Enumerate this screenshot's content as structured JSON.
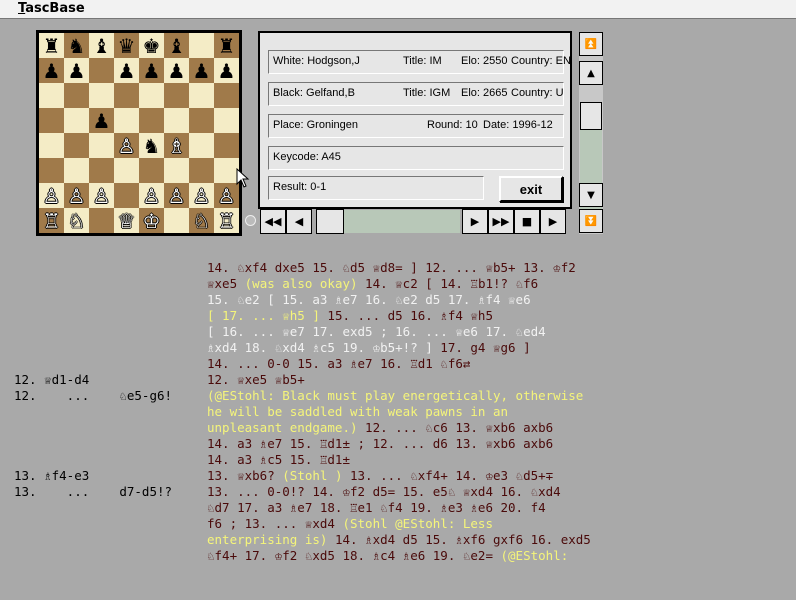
{
  "app": {
    "title": "TascBase"
  },
  "board": {
    "rows": [
      [
        "♜",
        "♞",
        "♝",
        "♛",
        "♚",
        "♝",
        "",
        ""
      ],
      [
        "♟",
        "♟",
        "",
        "♟",
        "♟",
        "♟",
        "♟",
        "♟"
      ],
      [
        "",
        "",
        "",
        "",
        "",
        "",
        "",
        ""
      ],
      [
        "",
        "",
        "♟",
        "",
        "",
        "",
        "",
        ""
      ],
      [
        "",
        "",
        "",
        "♙",
        "♞",
        "♗",
        "",
        ""
      ],
      [
        "",
        "",
        "",
        "",
        "",
        "",
        "",
        ""
      ],
      [
        "♙",
        "♙",
        "♙",
        "",
        "♙",
        "♙",
        "♙",
        "♙"
      ],
      [
        "♖",
        "♘",
        "",
        "♕",
        "♔",
        "",
        "♘",
        "♖"
      ]
    ],
    "colors": [
      [
        "b",
        "b",
        "b",
        "b",
        "b",
        "b",
        "",
        ""
      ],
      [
        "b",
        "b",
        "",
        "b",
        "b",
        "b",
        "b",
        "b"
      ],
      [
        "",
        "",
        "",
        "",
        "",
        "",
        "",
        ""
      ],
      [
        "",
        "",
        "b",
        "",
        "",
        "",
        "",
        ""
      ],
      [
        "",
        "",
        "",
        "w",
        "b",
        "w",
        "",
        ""
      ],
      [
        "",
        "",
        "",
        "",
        "",
        "",
        "",
        ""
      ],
      [
        "w",
        "w",
        "w",
        "",
        "w",
        "w",
        "w",
        "w"
      ],
      [
        "w",
        "w",
        "",
        "w",
        "w",
        "",
        "w",
        "w"
      ]
    ],
    "extra": {
      "h8": "♜"
    }
  },
  "game": {
    "white": "White: Hodgson,J",
    "white_title": "Title: IM",
    "white_elo": "Elo: 2550",
    "white_country": "Country: EN",
    "black": "Black: Gelfand,B",
    "black_title": "Title: IGM",
    "black_elo": "Elo: 2665",
    "black_country": "Country: U",
    "place": "Place: Groningen",
    "round": "Round: 10",
    "date": "Date: 1996-12",
    "keycode": "Keycode: A45",
    "result": "Result: 0-1",
    "exit_label": "exit"
  },
  "icons": {
    "first": "◀◀",
    "prev": "◀",
    "next": "▶",
    "last": "▶▶",
    "stop": "■",
    "play": "▶",
    "scroll_top": "⏫",
    "scroll_up": "▲",
    "scroll_down": "▼",
    "scroll_bottom": "⏬"
  },
  "moves": {
    "l1": "14. ♘xf4 dxe5 15. ♘d5 ♕d8= ] 12. ... ♕b5+ 13. ♔f2",
    "l2a": "♕xe5 ",
    "l2b": "(was also okay)",
    "l2c": " 14. ♕c2 ",
    "l2d": "[ 14. ♖b1!? ♘f6",
    "l3": "15. ♘e2 [ 15. a3 ♗e7 16. ♘e2 d5 17. ♗f4 ♕e6",
    "l4a": "[ 17. ... ♕h5 ]",
    "l4b": " 15. ... d5 16. ♗f4 ♕h5",
    "l5a": "[ 16. ... ♕e7 17. exd5 ; 16. ... ♕e6 17. ♘ed4",
    "l5b": "",
    "l6a": "♗xd4 18. ♘xd4 ♗c5 19. ♔b5+!? ] ",
    "l6b": "17. g4 ♕g6 ]",
    "l7": "14. ... 0-0 15. a3 ♗e7 16. ♖d1 ♘f6⇄",
    "n12w": "12. ♕d1-d4",
    "l8": "12. ♕xe5 ♕b5+",
    "n12b": "12.    ...    ♘e5-g6!",
    "l9": "(@EStohl: Black must play energetically, otherwise",
    "l10": "he will be saddled with weak pawns in an",
    "l11a": "unpleasant endgame.)",
    "l11b": " 12. ... ♘c6 13. ♕xb6 axb6",
    "l12": "14. a3 ♗e7 15. ♖d1± ; 12. ... d6 13. ♕xb6 axb6",
    "l13": "14. a3 ♗c5 15. ♖d1±",
    "n13w": "13. ♗f4-e3",
    "l14a": "13. ♕xb6? ",
    "l14b": "(Stohl )",
    "l14c": " 13. ... ♘xf4+ 14. ♔e3 ♘d5+∓",
    "n13b": "13.    ...    d7-d5!?",
    "l15": "13. ... 0-0!? 14. ♔f2 d5= 15. e5♘ ♕xd4 16. ♘xd4",
    "l16": "♘d7 17. a3 ♗e7 18. ♖e1 ♘f4 19. ♗e3 ♗e6 20. f4",
    "l17a": "f6 ; 13. ... ♕xd4 ",
    "l17b": "(Stohl @EStohl: Less",
    "l18a": "enterprising is)",
    "l18b": " 14. ♗xd4 d5 15. ♗xf6 gxf6 16. exd5",
    "l19a": "♘f4+ 17. ♔f2 ♘xd5 18. ♗c4 ♗e6 19. ♘e2= ",
    "l19b": "(@EStohl:"
  }
}
